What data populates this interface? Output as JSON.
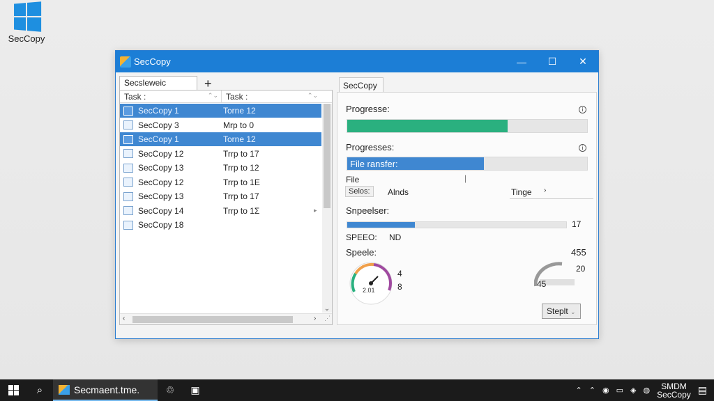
{
  "desktop": {
    "icon_label": "SecCopy"
  },
  "window": {
    "title": "SecCopy",
    "minimize": "—",
    "maximize": "☐",
    "close": "✕"
  },
  "left": {
    "tab_label": "Secsleweic",
    "add_label": "+",
    "col_task1": "Task :",
    "col_task2": "Task :",
    "rows": [
      {
        "name": "SecCopy 1",
        "dest": "Torne 12",
        "selected": true
      },
      {
        "name": "SecCopy 3",
        "dest": "Mrp to 0",
        "selected": false
      },
      {
        "name": "SecCopy 1",
        "dest": "Torne 12",
        "selected": true
      },
      {
        "name": "SecCopy 12",
        "dest": "Trrp to 17",
        "selected": false
      },
      {
        "name": "SecCopy 13",
        "dest": "Trrp to 12",
        "selected": false
      },
      {
        "name": "SecCopy 12",
        "dest": "Trrp to 1E",
        "selected": false
      },
      {
        "name": "SecCopy 13",
        "dest": "Trrp to 17",
        "selected": false
      },
      {
        "name": "SecCopy 14",
        "dest": "Trrp to 1Ʃ",
        "selected": false
      },
      {
        "name": "SecCopy 18",
        "dest": "",
        "selected": false
      }
    ]
  },
  "right": {
    "tab_label": "SecCopy",
    "progress1_label": "Progresse:",
    "progress1_value": 0.67,
    "progress2_label": "Progresses:",
    "progress2_text": "File ransfer:",
    "progress2_value": 0.57,
    "file_label": "File",
    "select_label": "Selos:",
    "alnds_label": "Alnds",
    "tinge_label": "Tinge",
    "speed_section_label": "Snpeelser:",
    "speed_bar_value": 0.31,
    "speed_bar_num": "17",
    "speeo_label": "SPEEO:",
    "nd_label": "ND",
    "speele_label": "Speele:",
    "speele_num": "455",
    "gauge_value": "2.01",
    "gauge_num_a": "4",
    "gauge_num_b": "8",
    "meter_num_top": "20",
    "meter_num_bottom": "45",
    "button_label": "Steplt"
  },
  "taskbar": {
    "app_label": "Secmaent.tme.",
    "clock_top": "SMDM",
    "clock_bottom": "SecCopy"
  },
  "colors": {
    "accent": "#1c7ed6",
    "green": "#2ab07f",
    "blue": "#3f87d1"
  }
}
